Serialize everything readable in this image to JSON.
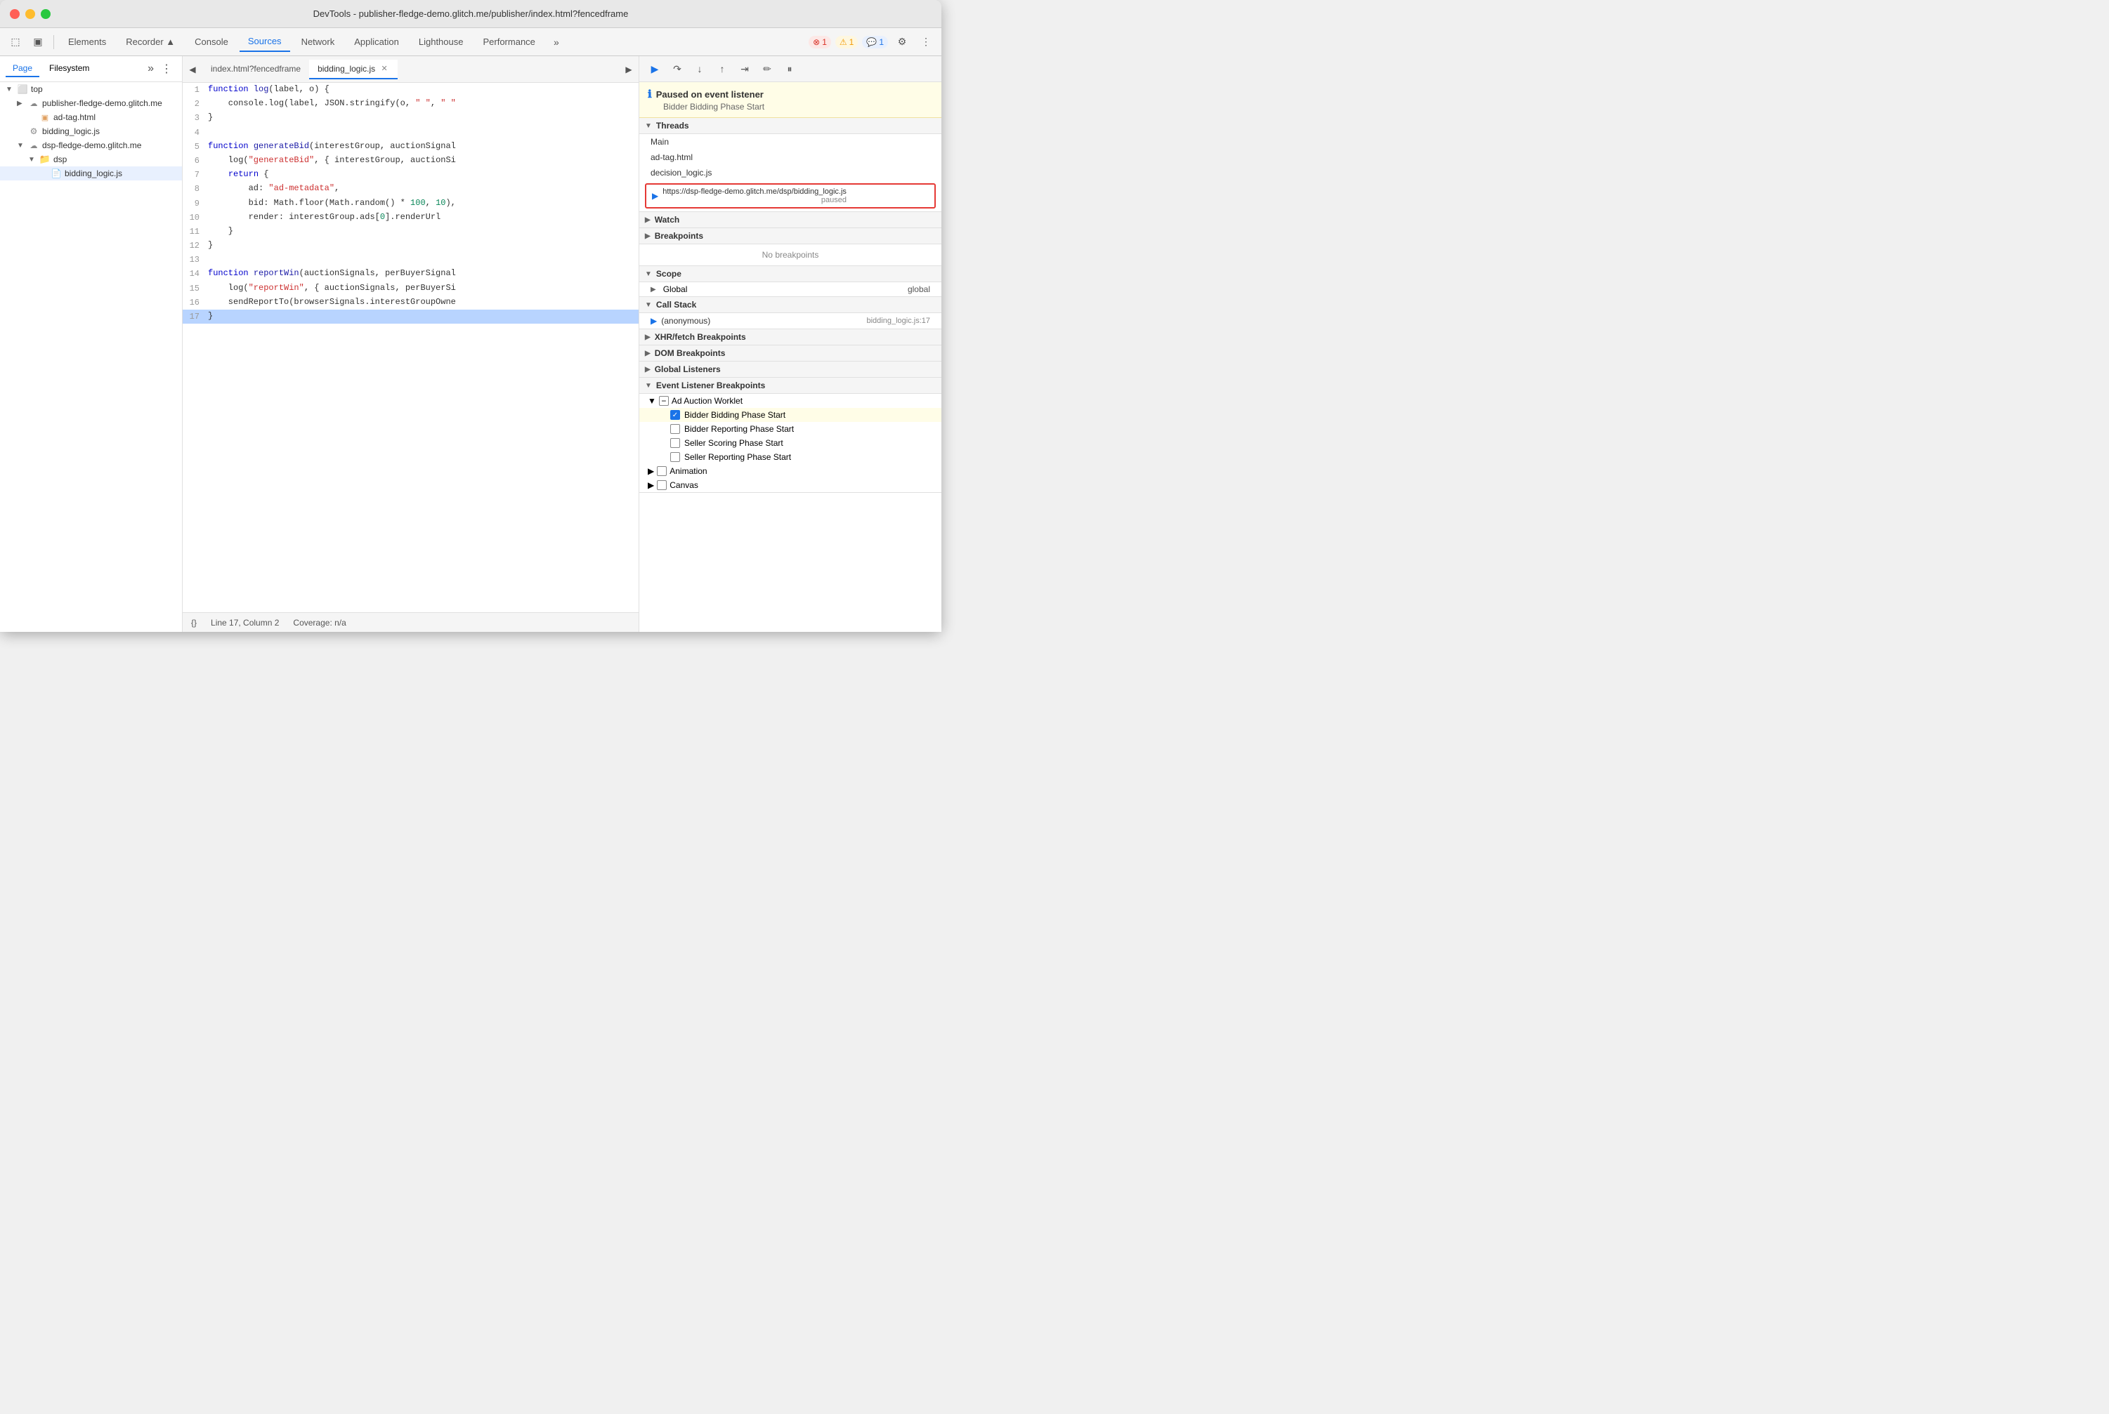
{
  "titlebar": {
    "title": "DevTools - publisher-fledge-demo.glitch.me/publisher/index.html?fencedframe"
  },
  "toolbar": {
    "tabs": [
      {
        "id": "elements",
        "label": "Elements",
        "active": false
      },
      {
        "id": "recorder",
        "label": "Recorder ▲",
        "active": false
      },
      {
        "id": "console",
        "label": "Console",
        "active": false
      },
      {
        "id": "sources",
        "label": "Sources",
        "active": true
      },
      {
        "id": "network",
        "label": "Network",
        "active": false
      },
      {
        "id": "application",
        "label": "Application",
        "active": false
      },
      {
        "id": "lighthouse",
        "label": "Lighthouse",
        "active": false
      },
      {
        "id": "performance",
        "label": "Performance",
        "active": false
      }
    ],
    "badges": {
      "error": "1",
      "warn": "1",
      "info": "1"
    }
  },
  "sidebar": {
    "tabs": [
      "Page",
      "Filesystem"
    ],
    "tree": [
      {
        "id": "top",
        "label": "top",
        "indent": 0,
        "type": "root",
        "expanded": true
      },
      {
        "id": "publisher",
        "label": "publisher-fledge-demo.glitch.me",
        "indent": 1,
        "type": "cloud",
        "expanded": false
      },
      {
        "id": "ad-tag",
        "label": "ad-tag.html",
        "indent": 2,
        "type": "file-html"
      },
      {
        "id": "bidding-logic-root",
        "label": "bidding_logic.js",
        "indent": 1,
        "type": "file-gear",
        "expanded": false,
        "selected": false
      },
      {
        "id": "dsp-fledge",
        "label": "dsp-fledge-demo.glitch.me",
        "indent": 1,
        "type": "cloud",
        "expanded": true
      },
      {
        "id": "dsp-folder",
        "label": "dsp",
        "indent": 2,
        "type": "folder",
        "expanded": true
      },
      {
        "id": "bidding-logic-js",
        "label": "bidding_logic.js",
        "indent": 3,
        "type": "file-yellow",
        "selected": true
      }
    ]
  },
  "editor": {
    "tabs": [
      {
        "id": "index-html",
        "label": "index.html?fencedframe",
        "active": false,
        "closable": false
      },
      {
        "id": "bidding-logic",
        "label": "bidding_logic.js",
        "active": true,
        "closable": true
      }
    ],
    "code_lines": [
      {
        "num": 1,
        "content": "function log(label, o) {",
        "highlighted": false
      },
      {
        "num": 2,
        "content": "    console.log(label, JSON.stringify(o, \" \", \"",
        "highlighted": false
      },
      {
        "num": 3,
        "content": "}",
        "highlighted": false
      },
      {
        "num": 4,
        "content": "",
        "highlighted": false
      },
      {
        "num": 5,
        "content": "function generateBid(interestGroup, auctionSignal",
        "highlighted": false
      },
      {
        "num": 6,
        "content": "    log(\"generateBid\", { interestGroup, auctionSi",
        "highlighted": false
      },
      {
        "num": 7,
        "content": "    return {",
        "highlighted": false
      },
      {
        "num": 8,
        "content": "        ad: \"ad-metadata\",",
        "highlighted": false
      },
      {
        "num": 9,
        "content": "        bid: Math.floor(Math.random() * 100, 10),",
        "highlighted": false
      },
      {
        "num": 10,
        "content": "        render: interestGroup.ads[0].renderUrl",
        "highlighted": false
      },
      {
        "num": 11,
        "content": "    }",
        "highlighted": false
      },
      {
        "num": 12,
        "content": "}",
        "highlighted": false
      },
      {
        "num": 13,
        "content": "",
        "highlighted": false
      },
      {
        "num": 14,
        "content": "function reportWin(auctionSignals, perBuyerSignal",
        "highlighted": false
      },
      {
        "num": 15,
        "content": "    log(\"reportWin\", { auctionSignals, perBuyerSi",
        "highlighted": false
      },
      {
        "num": 16,
        "content": "    sendReportTo(browserSignals.interestGroupOwne",
        "highlighted": false
      },
      {
        "num": 17,
        "content": "}",
        "highlighted": true
      }
    ],
    "footer": {
      "cursor_icon": "{}",
      "line_col": "Line 17, Column 2",
      "coverage": "Coverage: n/a"
    }
  },
  "right_panel": {
    "debug_buttons": [
      "resume",
      "step-over",
      "step-into",
      "step-out",
      "step",
      "edit",
      "pause"
    ],
    "paused_banner": {
      "title": "Paused on event listener",
      "subtitle": "Bidder Bidding Phase Start"
    },
    "threads": {
      "section_label": "Threads",
      "items": [
        {
          "id": "main",
          "label": "Main",
          "active": false
        },
        {
          "id": "ad-tag",
          "label": "ad-tag.html",
          "active": false
        },
        {
          "id": "decision-logic",
          "label": "decision_logic.js",
          "active": false
        },
        {
          "id": "bidding-logic-thread",
          "label": "https://dsp-fledge-demo.glitch.me/dsp/bidding_logic.js",
          "status": "paused",
          "active": true
        }
      ]
    },
    "watch": {
      "section_label": "Watch"
    },
    "breakpoints": {
      "section_label": "Breakpoints",
      "no_breakpoints": "No breakpoints"
    },
    "scope": {
      "section_label": "Scope",
      "items": [
        {
          "label": "Global",
          "value": "global"
        }
      ]
    },
    "call_stack": {
      "section_label": "Call Stack",
      "items": [
        {
          "label": "(anonymous)",
          "location": "bidding_logic.js:17"
        }
      ]
    },
    "xhr_breakpoints": {
      "section_label": "XHR/fetch Breakpoints"
    },
    "dom_breakpoints": {
      "section_label": "DOM Breakpoints"
    },
    "global_listeners": {
      "section_label": "Global Listeners"
    },
    "event_listener_breakpoints": {
      "section_label": "Event Listener Breakpoints",
      "sub_sections": [
        {
          "label": "Ad Auction Worklet",
          "expanded": true,
          "items": [
            {
              "label": "Bidder Bidding Phase Start",
              "checked": true,
              "highlighted": true
            },
            {
              "label": "Bidder Reporting Phase Start",
              "checked": false
            },
            {
              "label": "Seller Scoring Phase Start",
              "checked": false
            },
            {
              "label": "Seller Reporting Phase Start",
              "checked": false
            }
          ]
        },
        {
          "label": "Animation",
          "expanded": false,
          "items": []
        },
        {
          "label": "Canvas",
          "expanded": false,
          "items": []
        }
      ]
    }
  }
}
